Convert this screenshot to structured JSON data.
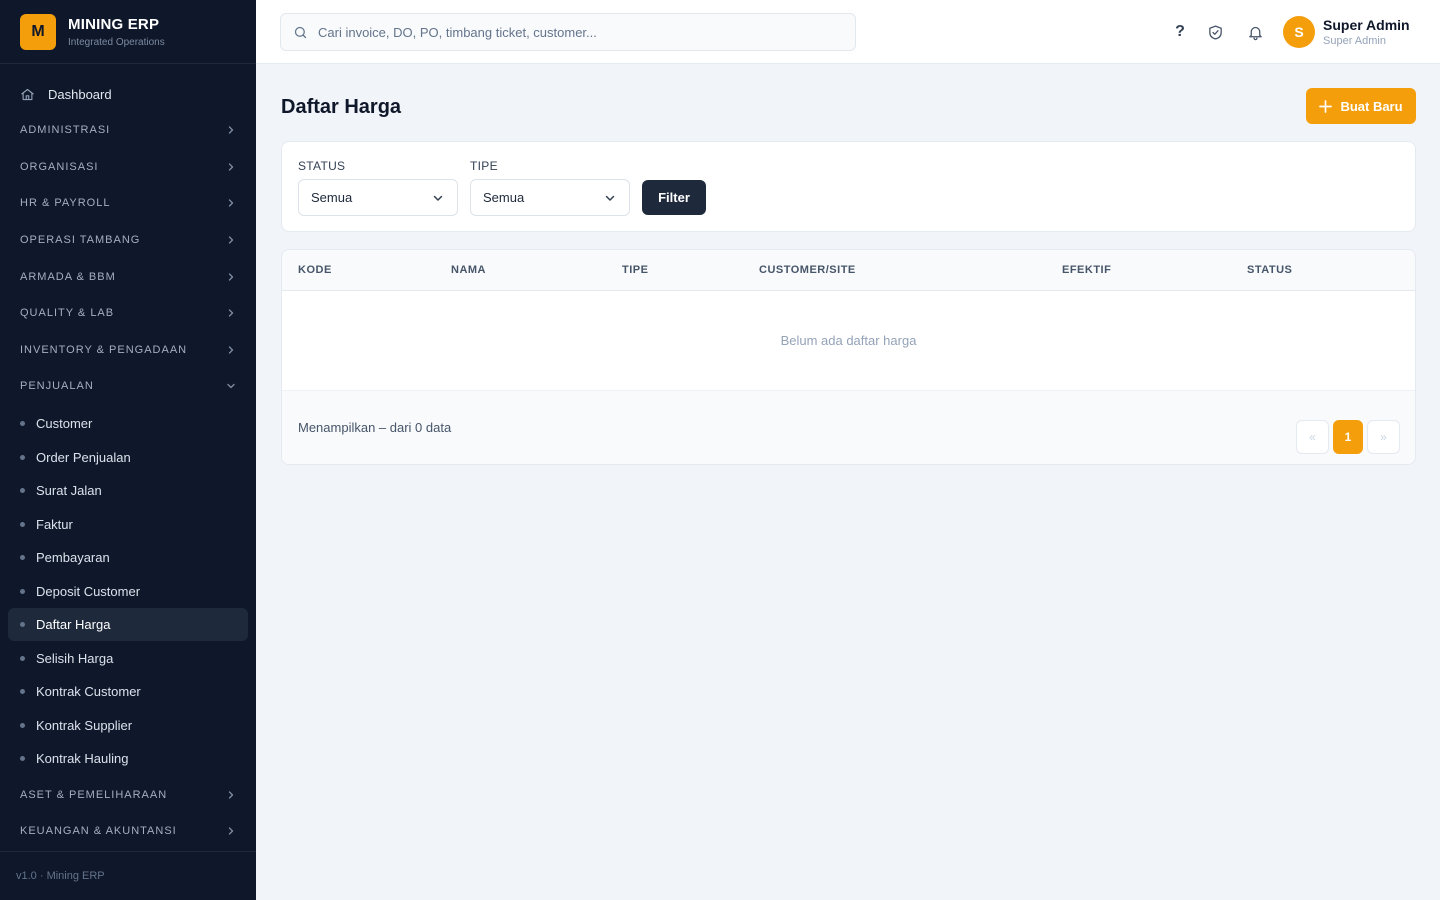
{
  "brand": {
    "logo_letter": "M",
    "title": "MINING ERP",
    "subtitle": "Integrated Operations"
  },
  "sidebar": {
    "dashboard_label": "Dashboard",
    "groups_before": [
      "ADMINISTRASI",
      "ORGANISASI",
      "HR & PAYROLL",
      "OPERASI TAMBANG",
      "ARMADA & BBM",
      "QUALITY & LAB",
      "INVENTORY & PENGADAAN"
    ],
    "expanded_group": "PENJUALAN",
    "sub_items": [
      "Customer",
      "Order Penjualan",
      "Surat Jalan",
      "Faktur",
      "Pembayaran",
      "Deposit Customer",
      "Daftar Harga",
      "Selisih Harga",
      "Kontrak Customer",
      "Kontrak Supplier",
      "Kontrak Hauling"
    ],
    "active_item": "Daftar Harga",
    "groups_after": [
      "ASET & PEMELIHARAAN",
      "KEUANGAN & AKUNTANSI"
    ],
    "footer": "v1.0 · Mining ERP"
  },
  "topbar": {
    "search_placeholder": "Cari invoice, DO, PO, timbang ticket, customer...",
    "help_label": "?",
    "user": {
      "initial": "S",
      "name": "Super Admin",
      "role": "Super Admin"
    }
  },
  "page": {
    "title": "Daftar Harga",
    "new_button": "Buat Baru"
  },
  "filters": {
    "status_label": "STATUS",
    "status_value": "Semua",
    "type_label": "TIPE",
    "type_value": "Semua",
    "filter_button": "Filter"
  },
  "table": {
    "columns": [
      "KODE",
      "NAMA",
      "TIPE",
      "CUSTOMER/SITE",
      "EFEKTIF",
      "STATUS"
    ],
    "empty_message": "Belum ada daftar harga",
    "showing_text": "Menampilkan – dari 0 data",
    "pagination": {
      "prev": "«",
      "current": "1",
      "next": "»"
    }
  },
  "colors": {
    "accent": "#f59e0b",
    "sidebar_bg": "#0f172a",
    "dark_button": "#1e293b"
  }
}
